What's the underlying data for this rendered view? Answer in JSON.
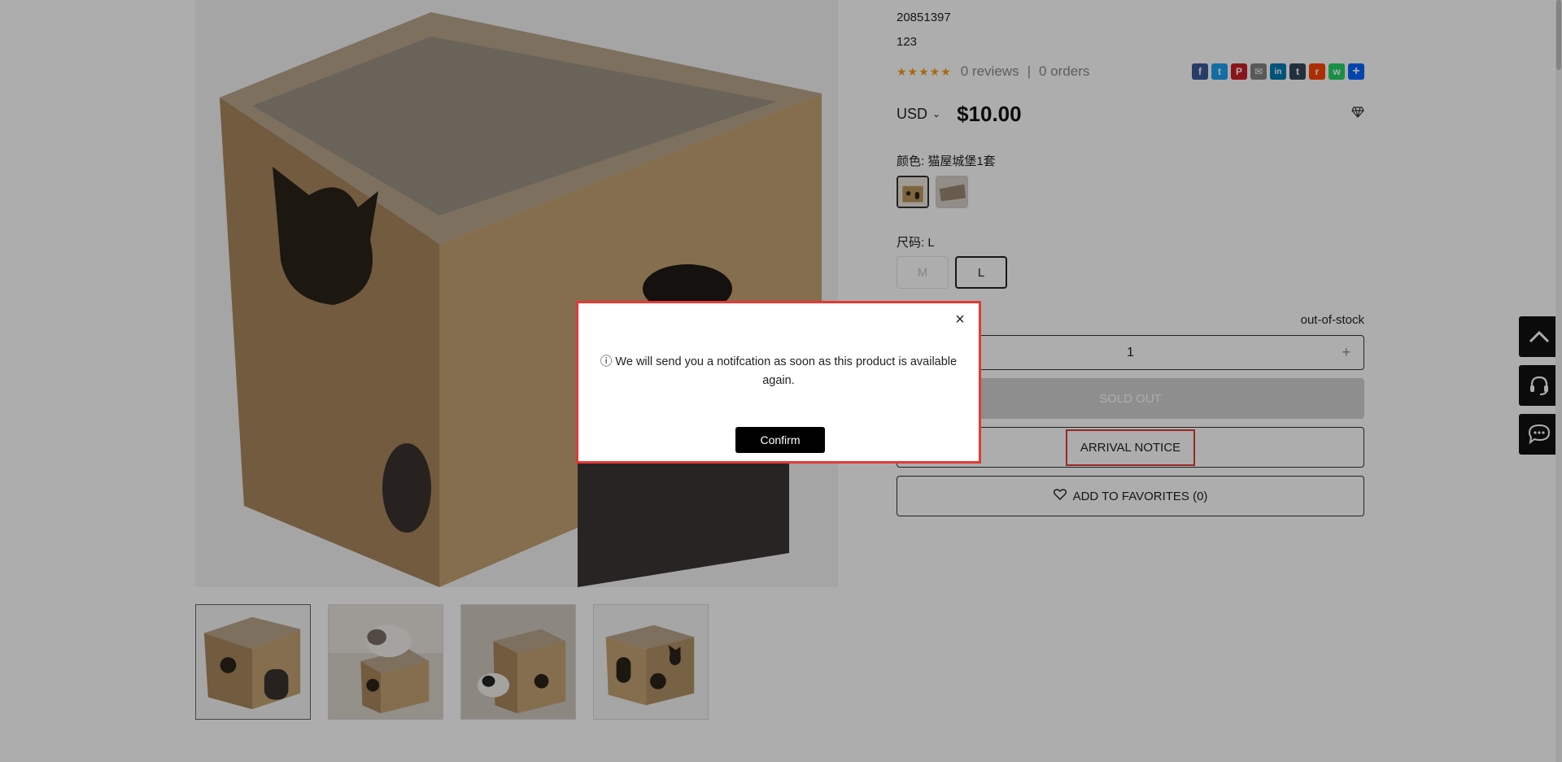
{
  "product": {
    "sku": "20851397",
    "subtitle": "123",
    "stars": "★★★★★",
    "reviews": "0 reviews",
    "separator": "|",
    "orders": "0 orders",
    "currency": "USD",
    "price": "$10.00",
    "color_label": "颜色: 猫屋城堡1套",
    "size_label": "尺码: L",
    "sizes": [
      "M",
      "L"
    ],
    "stock_status": "out-of-stock",
    "quantity": "1",
    "sold_out_label": "SOLD OUT",
    "arrival_notice_label": "ARRIVAL NOTICE",
    "favorites_label": "ADD TO FAVORITES (0)"
  },
  "share": [
    {
      "name": "Facebook",
      "glyph": "f",
      "color": "#3b5998"
    },
    {
      "name": "Twitter",
      "glyph": "t",
      "color": "#1da1f2"
    },
    {
      "name": "Pinterest",
      "glyph": "P",
      "color": "#cb2027"
    },
    {
      "name": "Email",
      "glyph": "✉",
      "color": "#848484"
    },
    {
      "name": "LinkedIn",
      "glyph": "in",
      "color": "#007bb5"
    },
    {
      "name": "Tumblr",
      "glyph": "t",
      "color": "#35465c"
    },
    {
      "name": "Reddit",
      "glyph": "r",
      "color": "#ff4500"
    },
    {
      "name": "WhatsApp",
      "glyph": "w",
      "color": "#25d366"
    },
    {
      "name": "Share",
      "glyph": "+",
      "color": "#0166ff"
    }
  ],
  "modal": {
    "message": "ⓘ We will send you a notifcation as soon as this product is available again.",
    "confirm_label": "Confirm",
    "close_glyph": "×"
  },
  "colors": {
    "accent_border": "#e53935",
    "star": "#f0a020",
    "button_dark": "#000000"
  }
}
